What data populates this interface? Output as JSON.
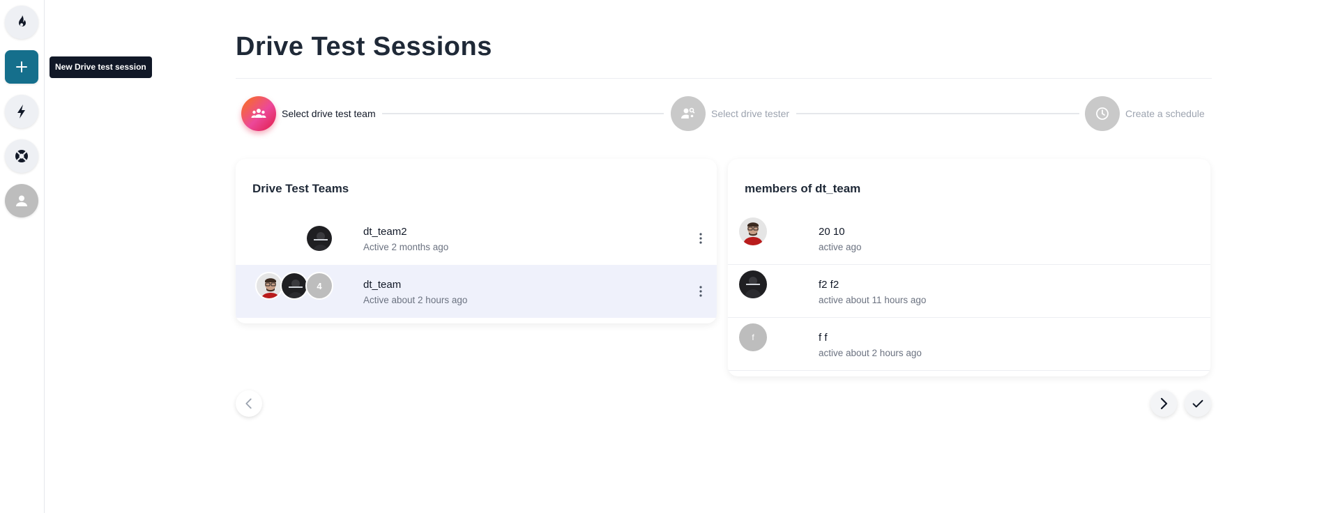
{
  "sidebar": {
    "tooltip": "New Drive test session",
    "items": [
      {
        "icon": "flame-icon"
      },
      {
        "icon": "plus-icon",
        "active": true
      },
      {
        "icon": "lightning-icon"
      },
      {
        "icon": "lifebuoy-icon"
      },
      {
        "icon": "user-icon"
      }
    ]
  },
  "page": {
    "title": "Drive Test Sessions"
  },
  "stepper": {
    "steps": [
      {
        "label": "Select drive test team",
        "active": true,
        "icon": "group-icon"
      },
      {
        "label": "Select drive tester",
        "active": false,
        "icon": "person-search-icon"
      },
      {
        "label": "Create a schedule",
        "active": false,
        "icon": "clock-icon"
      }
    ]
  },
  "teams_card": {
    "title": "Drive Test Teams",
    "teams": [
      {
        "name": "dt_team2",
        "status": "Active 2 months ago",
        "selected": false
      },
      {
        "name": "dt_team",
        "status": "Active about 2 hours ago",
        "selected": true,
        "extra_count": "4"
      }
    ]
  },
  "members_card": {
    "title": "members of dt_team",
    "members": [
      {
        "name": "20 10",
        "status": "active ago"
      },
      {
        "name": "f2 f2",
        "status": "active about 11 hours ago"
      },
      {
        "name": "f f",
        "status": "active about 2 hours ago",
        "initial": "f"
      }
    ]
  },
  "colors": {
    "accent": "#156f8c",
    "step_gradient_start": "#f97316",
    "step_gradient_end": "#e11d48",
    "selected_row": "#eff1fb"
  }
}
